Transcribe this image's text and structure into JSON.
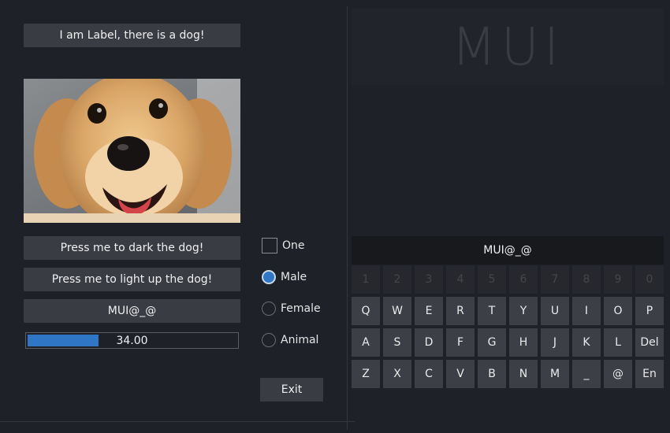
{
  "left": {
    "label": "I am Label, there is a dog!",
    "dark_button": "Press me to dark the dog!",
    "light_button": "Press me to light up the dog!",
    "text_input_value": "MUI@_@",
    "progress": {
      "value": 34.0,
      "text": "34.00"
    },
    "checkbox": {
      "label": "One",
      "checked": false
    },
    "radios": [
      {
        "label": "Male",
        "selected": true
      },
      {
        "label": "Female",
        "selected": false
      },
      {
        "label": "Animal",
        "selected": false
      }
    ],
    "exit_button": "Exit"
  },
  "right": {
    "title": "MUI",
    "keyboard": {
      "input_value": "MUI@_@",
      "number_row": [
        "1",
        "2",
        "3",
        "4",
        "5",
        "6",
        "7",
        "8",
        "9",
        "0"
      ],
      "row1": [
        "Q",
        "W",
        "E",
        "R",
        "T",
        "Y",
        "U",
        "I",
        "O",
        "P"
      ],
      "row2": [
        "A",
        "S",
        "D",
        "F",
        "G",
        "H",
        "J",
        "K",
        "L",
        "Del"
      ],
      "row3": [
        "Z",
        "X",
        "C",
        "V",
        "B",
        "N",
        "M",
        "_",
        "@",
        "En"
      ]
    }
  },
  "colors": {
    "background": "#1f2128",
    "control": "#3a3c43",
    "accent": "#2f77c5"
  }
}
